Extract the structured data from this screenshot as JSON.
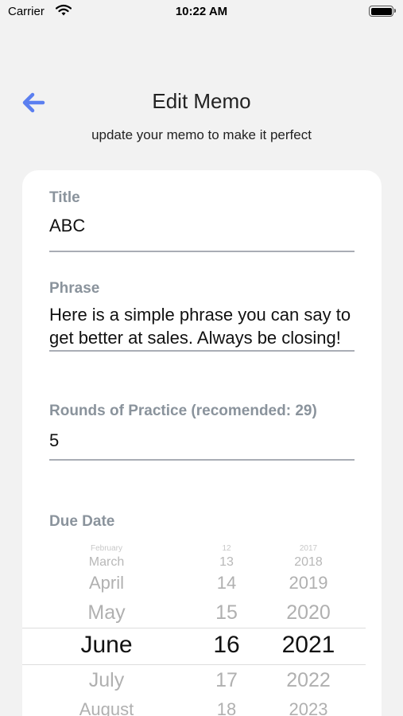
{
  "status_bar": {
    "carrier": "Carrier",
    "time": "10:22 AM"
  },
  "header": {
    "title": "Edit Memo",
    "subtitle": "update your memo to make it perfect"
  },
  "form": {
    "title_label": "Title",
    "title_value": "ABC",
    "phrase_label": "Phrase",
    "phrase_value": "Here is a simple phrase you can say to get better at sales. Always be closing!",
    "rounds_label": "Rounds of Practice (recomended: 29)",
    "rounds_value": "5",
    "due_label": "Due Date"
  },
  "picker": {
    "months": [
      "February",
      "March",
      "April",
      "May",
      "June",
      "July",
      "August"
    ],
    "days": [
      "12",
      "13",
      "14",
      "15",
      "16",
      "17",
      "18"
    ],
    "years": [
      "2017",
      "2018",
      "2019",
      "2020",
      "2021",
      "2022",
      "2023"
    ],
    "selected": {
      "month": "June",
      "day": "16",
      "year": "2021"
    }
  },
  "colors": {
    "accent": "#5b7ff0",
    "label": "#8a939c",
    "background": "#f2f2f2",
    "card": "#ffffff"
  },
  "icons": {
    "back": "arrow-left-icon",
    "wifi": "wifi-icon",
    "battery": "battery-icon"
  }
}
